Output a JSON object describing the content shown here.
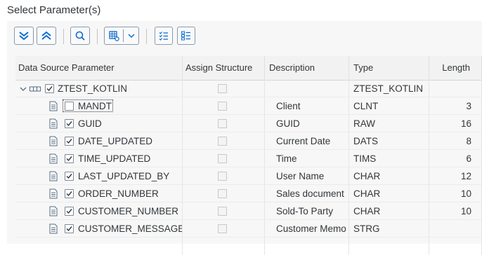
{
  "dialog": {
    "title": "Select Parameter(s)"
  },
  "toolbar": {
    "buttons": [
      "expand-all",
      "collapse-all",
      "search",
      "layout",
      "select-all",
      "deselect-all"
    ]
  },
  "columns": {
    "param": "Data Source Parameter",
    "assign": "Assign Structure",
    "desc": "Description",
    "type": "Type",
    "length": "Length"
  },
  "root": {
    "name": "ZTEST_KOTLIN",
    "type": "ZTEST_KOTLIN",
    "checked": true
  },
  "rows": [
    {
      "name": "MANDT",
      "desc": "Client",
      "type": "CLNT",
      "length": "3",
      "checked": false,
      "focused": true
    },
    {
      "name": "GUID",
      "desc": "GUID",
      "type": "RAW",
      "length": "16",
      "checked": true
    },
    {
      "name": "DATE_UPDATED",
      "desc": "Current Date",
      "type": "DATS",
      "length": "8",
      "checked": true
    },
    {
      "name": "TIME_UPDATED",
      "desc": "Time",
      "type": "TIMS",
      "length": "6",
      "checked": true
    },
    {
      "name": "LAST_UPDATED_BY",
      "desc": "User Name",
      "type": "CHAR",
      "length": "12",
      "checked": true
    },
    {
      "name": "ORDER_NUMBER",
      "desc": "Sales document",
      "type": "CHAR",
      "length": "10",
      "checked": true
    },
    {
      "name": "CUSTOMER_NUMBER",
      "desc": "Sold-To Party",
      "type": "CHAR",
      "length": "10",
      "checked": true
    },
    {
      "name": "CUSTOMER_MESSAGE",
      "desc": "Customer Memo",
      "type": "STRG",
      "length": "",
      "checked": true
    }
  ],
  "colors": {
    "accent": "#0a6ed1",
    "header_bg": "#f2f2f2"
  }
}
